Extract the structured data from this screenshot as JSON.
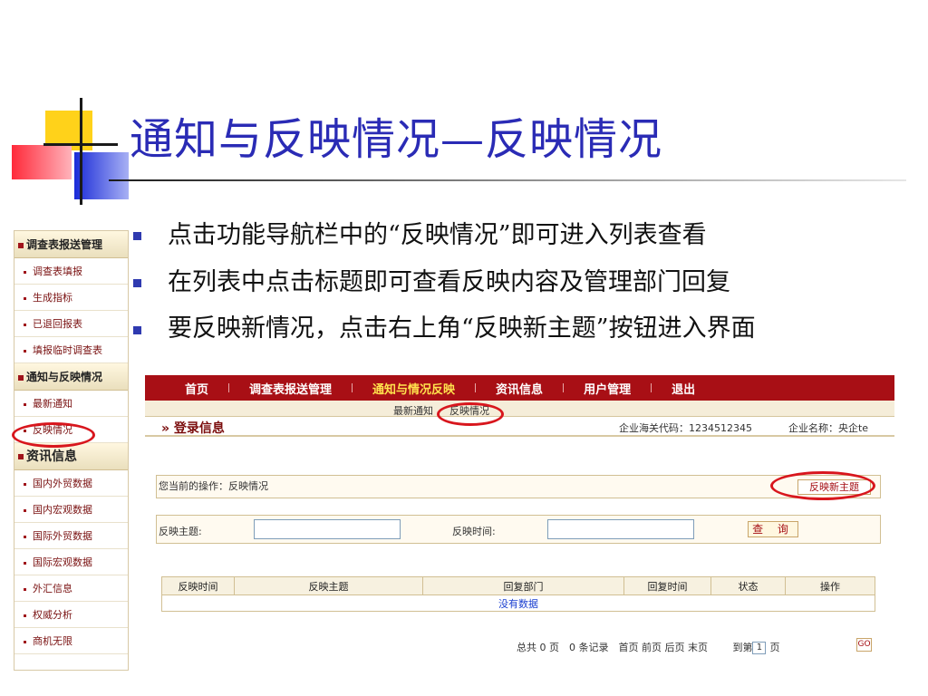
{
  "slide": {
    "title": "通知与反映情况—反映情况",
    "bullets": [
      "点击功能导航栏中的“反映情况”即可进入列表查看",
      "在列表中点击标题即可查看反映内容及管理部门回复",
      "要反映新情况，点击右上角“反映新主题”按钮进入界面"
    ]
  },
  "sidebar": {
    "sections": [
      {
        "title": "调查表报送管理",
        "items": [
          "调查表填报",
          "生成指标",
          "已退回报表",
          "填报临时调查表"
        ]
      },
      {
        "title": "通知与反映情况",
        "items": [
          "最新通知",
          "反映情况"
        ]
      },
      {
        "title": "资讯信息",
        "items": [
          "国内外贸数据",
          "国内宏观数据",
          "国际外贸数据",
          "国际宏观数据",
          "外汇信息",
          "权威分析",
          "商机无限"
        ]
      }
    ]
  },
  "app": {
    "nav": [
      "首页",
      "调查表报送管理",
      "通知与情况反映",
      "资讯信息",
      "用户管理",
      "退出"
    ],
    "active_nav": "通知与情况反映",
    "subnav": [
      "最新通知",
      "反映情况"
    ],
    "login_label": "» 登录信息",
    "customs_code": "企业海关代码：1234512345",
    "company_name": "企业名称：央企te",
    "current_op": "您当前的操作：反映情况",
    "new_topic_button": "反映新主题",
    "query": {
      "topic_label": "反映主题:",
      "time_label": "反映时间:",
      "button": "查 询"
    },
    "table": {
      "headers": [
        "反映时间",
        "反映主题",
        "回复部门",
        "回复时间",
        "状态",
        "操作"
      ],
      "empty": "没有数据"
    },
    "pager": {
      "text": "总共 0 页　0 条记录　首页 前页 后页 末页",
      "goto_prefix": "到第",
      "goto_value": "1",
      "goto_suffix": "页",
      "go": "GO"
    }
  },
  "colors": {
    "title": "#2a2bb5",
    "nav_bg": "#a80f15",
    "active_nav": "#ffe24d",
    "highlight": "#d8161d"
  }
}
